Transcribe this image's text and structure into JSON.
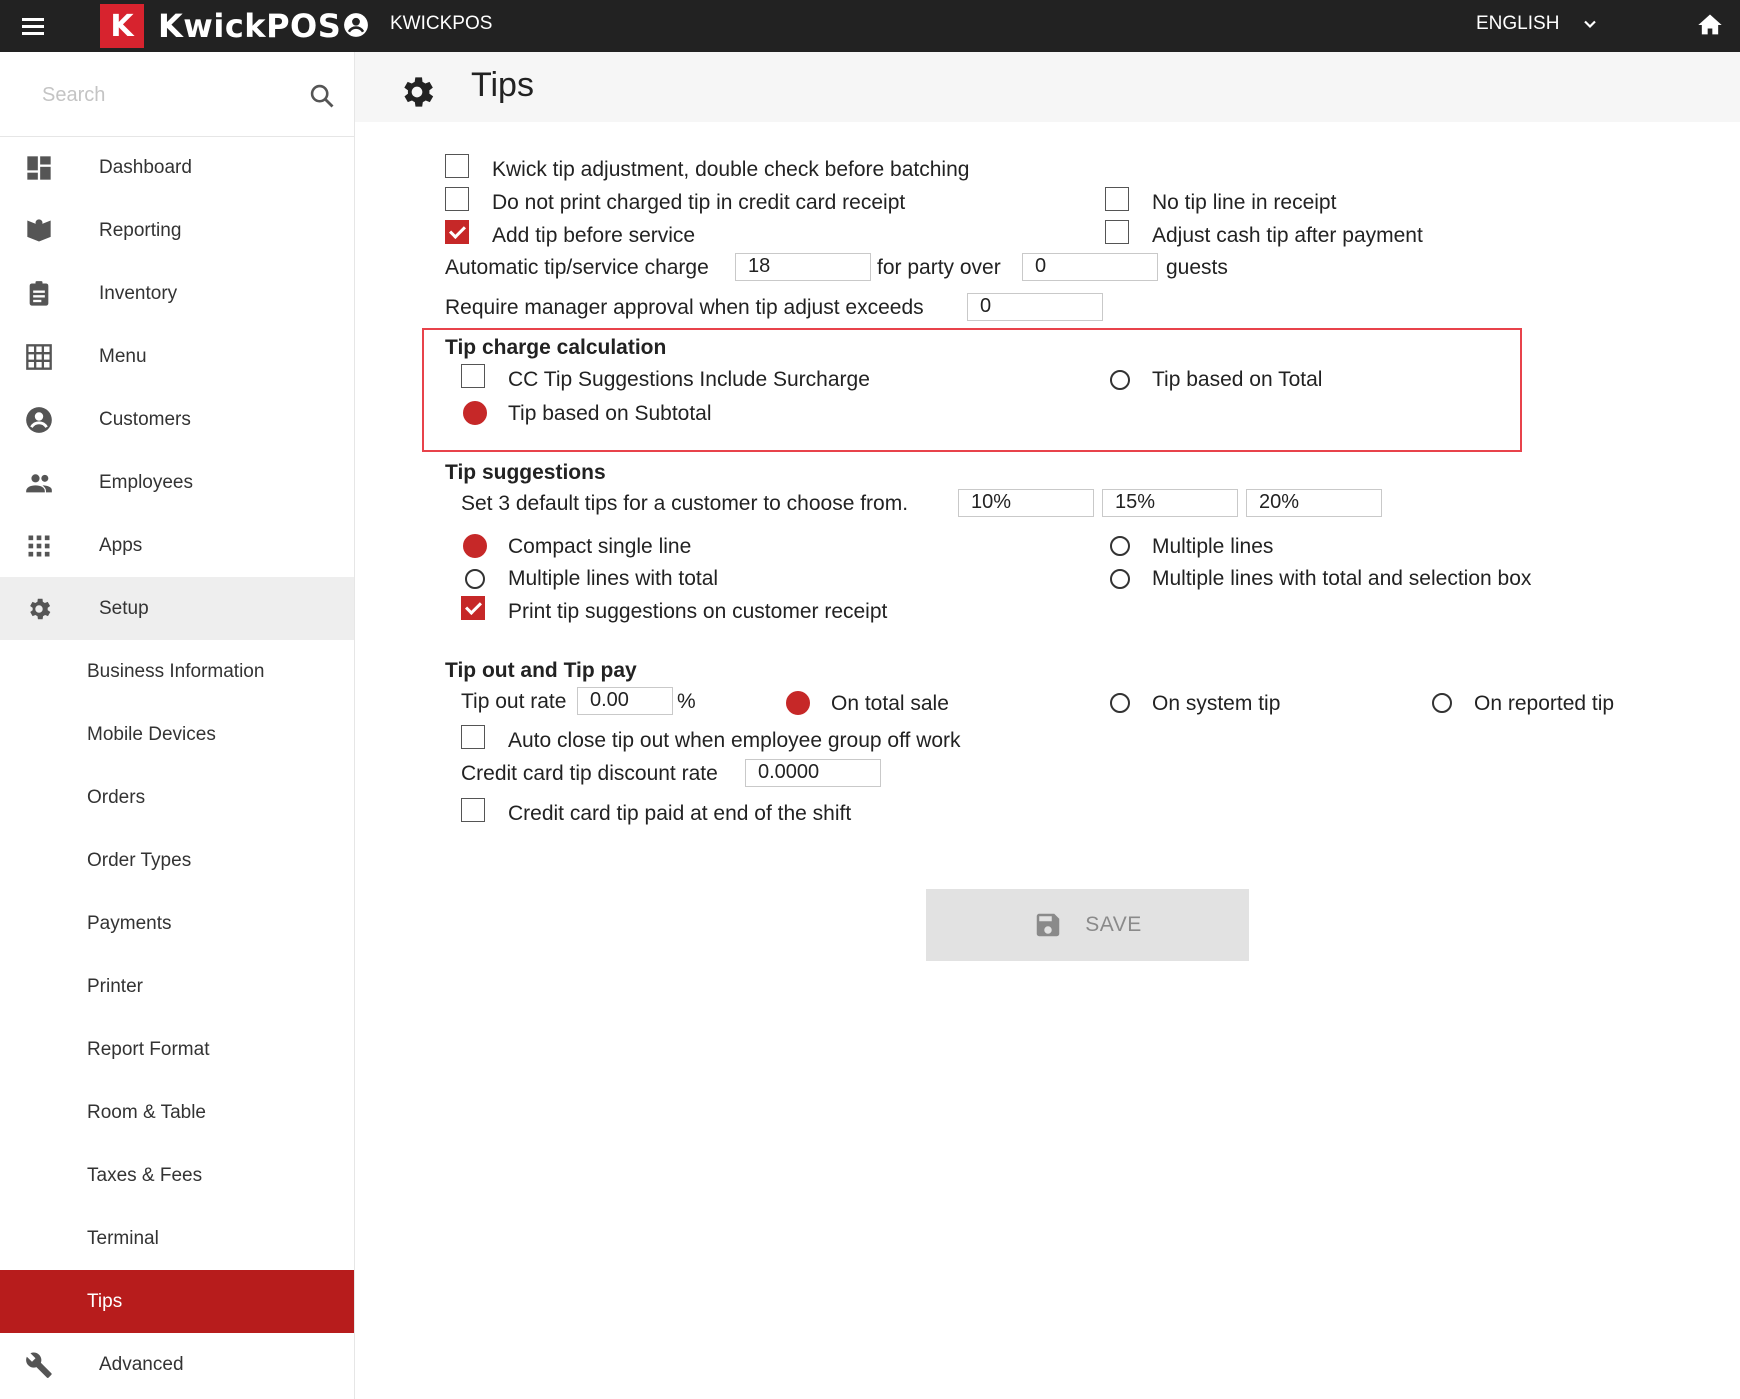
{
  "topbar": {
    "logo_letter": "K",
    "logo_text": "KwickPOS",
    "account_name": "KWICKPOS",
    "language": "ENGLISH"
  },
  "sidebar": {
    "search_placeholder": "Search",
    "items": [
      {
        "label": "Dashboard",
        "icon": "dashboard-icon"
      },
      {
        "label": "Reporting",
        "icon": "reporting-icon"
      },
      {
        "label": "Inventory",
        "icon": "clipboard-icon"
      },
      {
        "label": "Menu",
        "icon": "grid-icon"
      },
      {
        "label": "Customers",
        "icon": "customer-icon"
      },
      {
        "label": "Employees",
        "icon": "employees-icon"
      },
      {
        "label": "Apps",
        "icon": "apps-icon"
      },
      {
        "label": "Setup",
        "icon": "gear-icon"
      }
    ],
    "setup_items": [
      "Business Information",
      "Mobile Devices",
      "Orders",
      "Order Types",
      "Payments",
      "Printer",
      "Report Format",
      "Room & Table",
      "Taxes & Fees",
      "Terminal",
      "Tips"
    ],
    "selected_setup_item": "Tips",
    "advanced_label": "Advanced"
  },
  "page": {
    "title": "Tips"
  },
  "general": {
    "kwick_tip_adjust": {
      "label": "Kwick tip adjustment, double check before batching",
      "checked": false
    },
    "no_print_charged_tip": {
      "label": "Do not print charged tip in credit card receipt",
      "checked": false
    },
    "no_tip_line": {
      "label": "No tip line in receipt",
      "checked": false
    },
    "add_tip_before_service": {
      "label": "Add tip before service",
      "checked": true
    },
    "adjust_cash_tip": {
      "label": "Adjust cash tip after payment",
      "checked": false
    },
    "auto_tip_label": "Automatic tip/service charge",
    "auto_tip_value": "18",
    "party_over_label": "for party over",
    "party_over_value": "0",
    "guests_label": "guests",
    "manager_approval_label": "Require manager approval when tip adjust exceeds",
    "manager_approval_value": "0"
  },
  "tip_charge": {
    "title": "Tip charge calculation",
    "cc_surcharge": {
      "label": "CC Tip Suggestions Include Surcharge",
      "checked": false
    },
    "tip_on_total": {
      "label": "Tip based on Total",
      "selected": false
    },
    "tip_on_subtotal": {
      "label": "Tip based on Subtotal",
      "selected": true
    }
  },
  "tip_suggestions": {
    "title": "Tip suggestions",
    "defaults_label": "Set 3 default tips for a customer to choose from.",
    "tips": [
      "10%",
      "15%",
      "20%"
    ],
    "compact_single_line": {
      "label": "Compact single line",
      "selected": true
    },
    "multiple_lines": {
      "label": "Multiple lines",
      "selected": false
    },
    "multiple_lines_total": {
      "label": "Multiple lines with total",
      "selected": false
    },
    "multiple_lines_total_box": {
      "label": "Multiple lines with total and selection box",
      "selected": false
    },
    "print_on_receipt": {
      "label": "Print tip suggestions on customer receipt",
      "checked": true
    }
  },
  "tip_out": {
    "title": "Tip out and Tip pay",
    "rate_label": "Tip out rate",
    "rate_value": "0.00",
    "percent_sign": "%",
    "on_total_sale": {
      "label": "On total sale",
      "selected": true
    },
    "on_system_tip": {
      "label": "On system tip",
      "selected": false
    },
    "on_reported_tip": {
      "label": "On reported tip",
      "selected": false
    },
    "auto_close": {
      "label": "Auto close tip out when employee group off work",
      "checked": false
    },
    "cc_discount_label": "Credit card tip discount rate",
    "cc_discount_value": "0.0000",
    "cc_paid_end_shift": {
      "label": "Credit card tip paid at end of the shift",
      "checked": false
    }
  },
  "save_label": "SAVE",
  "colors": {
    "accent": "#c62828",
    "topbar": "#222222",
    "highlight_box": "#e8434b"
  }
}
